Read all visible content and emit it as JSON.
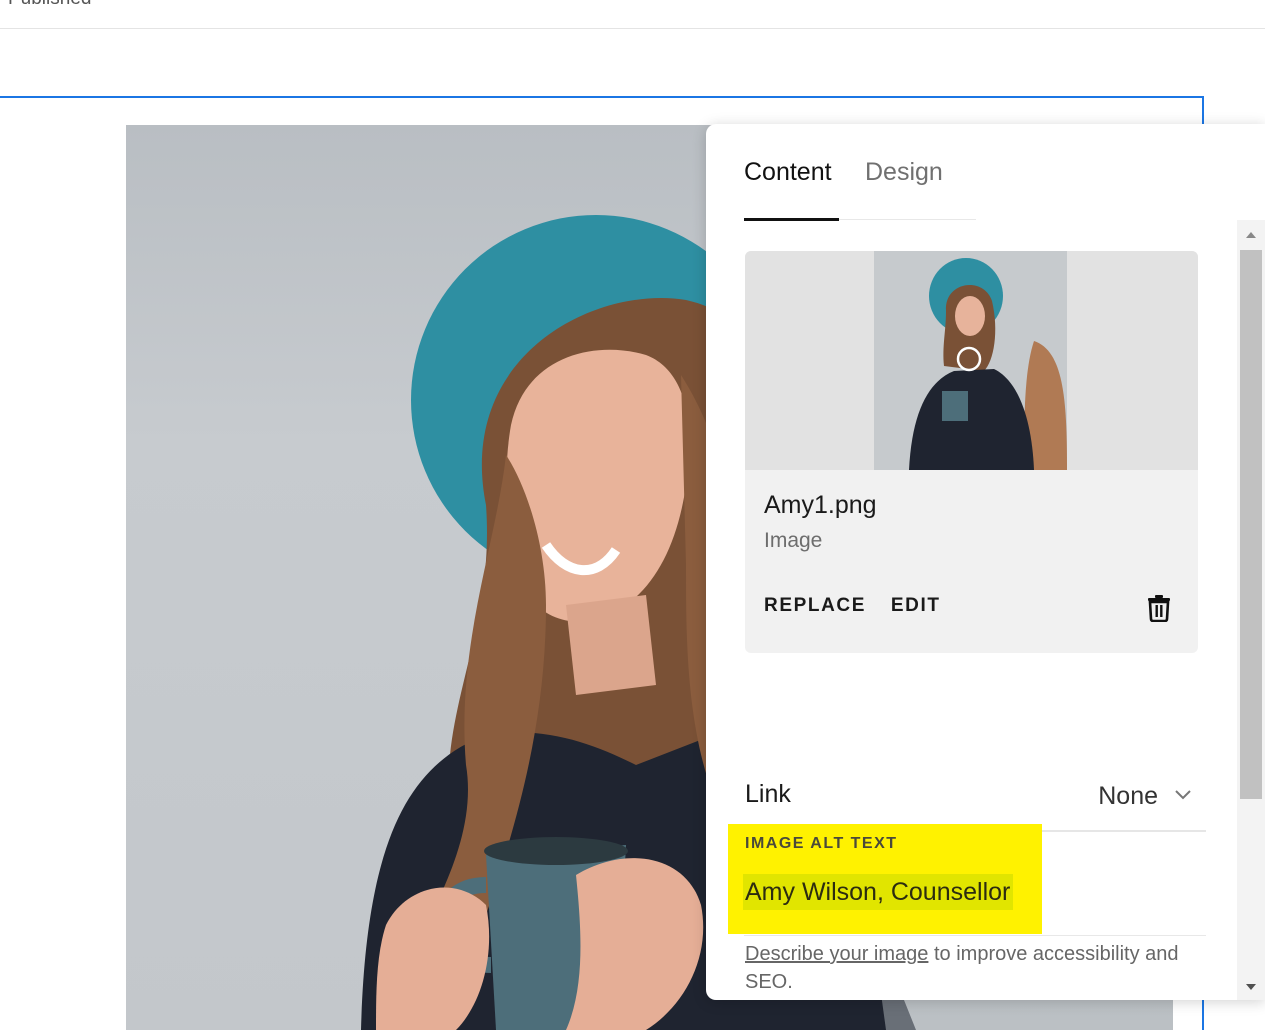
{
  "header": {
    "status_text": "Published"
  },
  "panel": {
    "tabs": [
      {
        "label": "Content",
        "active": true
      },
      {
        "label": "Design",
        "active": false
      }
    ],
    "file": {
      "name": "Amy1.png",
      "type": "Image",
      "actions": {
        "replace": "REPLACE",
        "edit": "EDIT"
      },
      "delete_icon": "trash-icon"
    },
    "link": {
      "label": "Link",
      "value": "None",
      "icon": "chevron-down-icon"
    },
    "alt_text": {
      "label": "IMAGE ALT TEXT",
      "value": "Amy Wilson, Counsellor",
      "help_link": "Describe your image",
      "help_rest": " to improve accessibility and SEO."
    }
  },
  "colors": {
    "selection_outline": "#1b76e4",
    "highlight": "#fff200",
    "photo_accent": "#2e8fa2"
  }
}
